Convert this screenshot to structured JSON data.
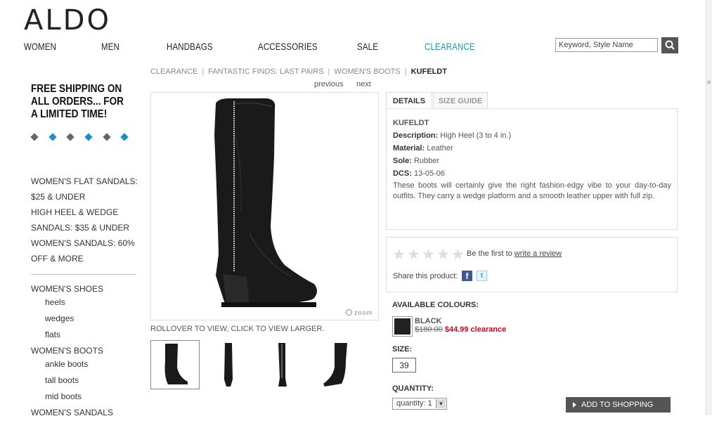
{
  "header": {
    "logo": "ALDO",
    "nav": [
      "WOMEN",
      "MEN",
      "HANDBAGS",
      "ACCESSORIES",
      "SALE",
      "CLEARANCE"
    ],
    "search_placeholder": "Keyword, Style Name"
  },
  "breadcrumb": {
    "items": [
      "CLEARANCE",
      "FANTASTIC FINDS: LAST PAIRS",
      "WOMEN'S BOOTS"
    ],
    "current": "KUFELDT",
    "separator": "|",
    "previous": "previous",
    "next": "next"
  },
  "sidebar": {
    "promo": "FREE SHIPPING ON ALL ORDERS... FOR A LIMITED TIME!",
    "dots": [
      "#666666",
      "#1a8fc4",
      "#666666",
      "#1a8fc4",
      "#666666",
      "#1a8fc4"
    ],
    "promo_links": [
      "WOMEN'S FLAT SANDALS:",
      "$25 & UNDER",
      "HIGH HEEL & WEDGE",
      "SANDALS: $35 & UNDER",
      "WOMEN'S SANDALS: 60%",
      "OFF & MORE"
    ],
    "categories": [
      {
        "label": "WOMEN'S SHOES",
        "subs": [
          "heels",
          "wedges",
          "flats"
        ]
      },
      {
        "label": "WOMEN'S BOOTS",
        "subs": [
          "ankle boots",
          "tall boots",
          "mid boots"
        ]
      },
      {
        "label": "WOMEN'S SANDALS",
        "subs": []
      }
    ]
  },
  "gallery": {
    "zoom_label": "zoom",
    "hint": "ROLLOVER TO VIEW, CLICK TO VIEW LARGER."
  },
  "tabs": [
    "DETAILS",
    "SIZE GUIDE"
  ],
  "details": {
    "name": "KUFELDT",
    "rows": [
      {
        "label": "Description:",
        "value": "High Heel (3 to 4 in.)"
      },
      {
        "label": "Material:",
        "value": "Leather"
      },
      {
        "label": "Sole:",
        "value": "Rubber"
      },
      {
        "label": "DCS:",
        "value": "13-05-06"
      }
    ],
    "description": "These boots will certainly give the right fashion-edgy vibe to your day-to-day outfits. They carry a wedge platform and a smooth leather upper with full zip."
  },
  "review": {
    "stars_filled": 0,
    "stars_total": 5,
    "prompt": "Be the first to",
    "link": "write a review",
    "share": "Share this product:"
  },
  "purchase": {
    "colours_label": "AVAILABLE COLOURS:",
    "colour_name": "BLACK",
    "old_price": "$180.00",
    "new_price": "$44.99 clearance",
    "size_label": "SIZE:",
    "size": "39",
    "quantity_label": "QUANTITY:",
    "quantity": "quantity: 1",
    "add_button": "ADD TO SHOPPING BAG"
  }
}
